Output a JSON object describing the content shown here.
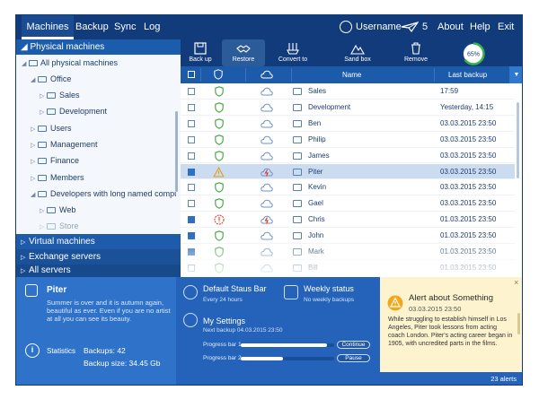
{
  "topbar": {
    "tabs": [
      "Machines",
      "Backup",
      "Sync",
      "Log"
    ],
    "username": "Username",
    "plane_count": "5",
    "about": "About",
    "help": "Help",
    "exit": "Exit"
  },
  "sidebar": {
    "header": "Physical machines",
    "tree": [
      {
        "label": "All physical machines"
      },
      {
        "label": "Office"
      },
      {
        "label": "Sales"
      },
      {
        "label": "Development"
      },
      {
        "label": "Users"
      },
      {
        "label": "Management"
      },
      {
        "label": "Finance"
      },
      {
        "label": "Members"
      },
      {
        "label": "Developers with long named compute..."
      },
      {
        "label": "Web"
      },
      {
        "label": "Store"
      }
    ],
    "groups": [
      "Virtual machines",
      "Exchange servers",
      "All servers"
    ]
  },
  "toolbar": {
    "backup_up": "Back up",
    "restore": "Restore",
    "convert_to": "Convert to",
    "sand_box": "Sand box",
    "remove": "Remove",
    "gauge_value": 65,
    "gauge_label": "65%"
  },
  "list": {
    "col_name": "Name",
    "col_last": "Last backup",
    "rows": [
      {
        "name": "Sales",
        "date": "17:59",
        "checked": false,
        "status": "ok",
        "cloud": "ok",
        "selected": false
      },
      {
        "name": "Development",
        "date": "Yesterday, 14:15",
        "checked": false,
        "status": "ok",
        "cloud": "ok",
        "selected": false
      },
      {
        "name": "Ben",
        "date": "03.03.2015  23:50",
        "checked": false,
        "status": "ok",
        "cloud": "ok",
        "selected": false
      },
      {
        "name": "Philip",
        "date": "03.03.2015  23:50",
        "checked": false,
        "status": "ok",
        "cloud": "ok",
        "selected": false
      },
      {
        "name": "James",
        "date": "03.03.2015  23:50",
        "checked": false,
        "status": "ok",
        "cloud": "ok",
        "selected": false
      },
      {
        "name": "Piter",
        "date": "03.03.2015  23:50",
        "checked": true,
        "status": "warn",
        "cloud": "error",
        "selected": true
      },
      {
        "name": "Kevin",
        "date": "03.03.2015  23:50",
        "checked": false,
        "status": "ok",
        "cloud": "ok",
        "selected": false
      },
      {
        "name": "Gael",
        "date": "03.03.2015  23:50",
        "checked": false,
        "status": "ok",
        "cloud": "ok",
        "selected": false
      },
      {
        "name": "Chris",
        "date": "01.03.2015  23:50",
        "checked": true,
        "status": "error",
        "cloud": "error",
        "selected": false
      },
      {
        "name": "John",
        "date": "01.03.2015  23:50",
        "checked": true,
        "status": "ok",
        "cloud": "ok",
        "selected": false
      },
      {
        "name": "Mark",
        "date": "01.03.2015  23:50",
        "checked": true,
        "status": "ok",
        "cloud": "ok",
        "selected": false
      },
      {
        "name": "Bill",
        "date": "01.03.2015  23:50",
        "checked": false,
        "status": "ok",
        "cloud": "ok",
        "selected": false
      }
    ]
  },
  "bottom": {
    "user_name": "Piter",
    "user_desc": "Summer is over and it is autumn again, beautiful as ever. Even if you are no artist at all you can see its beauty.",
    "stats_label": "Statistics",
    "backups": "Backups: 42",
    "backup_size": "Backup size: 34.45 Gb",
    "default_title": "Default  Staus Bar",
    "default_sub": "Every 24 hours",
    "weekly_title": "Weekly status",
    "weekly_sub": "No weekly backups",
    "settings_title": "My  Settings",
    "next_backup": "Next backup 04.03.2015  23:50",
    "pb1_label": "Progress bar 1",
    "pb1_value": 0.92,
    "pb1_button": "Continue",
    "pb2_label": "Progress bar 2",
    "pb2_value": 0.45,
    "pb2_button": "Pause"
  },
  "alert": {
    "title": "Alert about Something",
    "date": "03.03.2015  23:50",
    "body": "While struggling to establish himself in Los Angeles, Piter took lessons from acting coach London. Piter's acting career began in 1905, with uncredited parts in the films.",
    "footer": "23 alerts",
    "close": "×"
  },
  "colors": {
    "topbar": "#113b7a",
    "accent": "#1c5aaa",
    "ok": "#3aa63a",
    "warn": "#e0a020",
    "error": "#e2392b",
    "alert_bg": "#fdf4cf"
  }
}
